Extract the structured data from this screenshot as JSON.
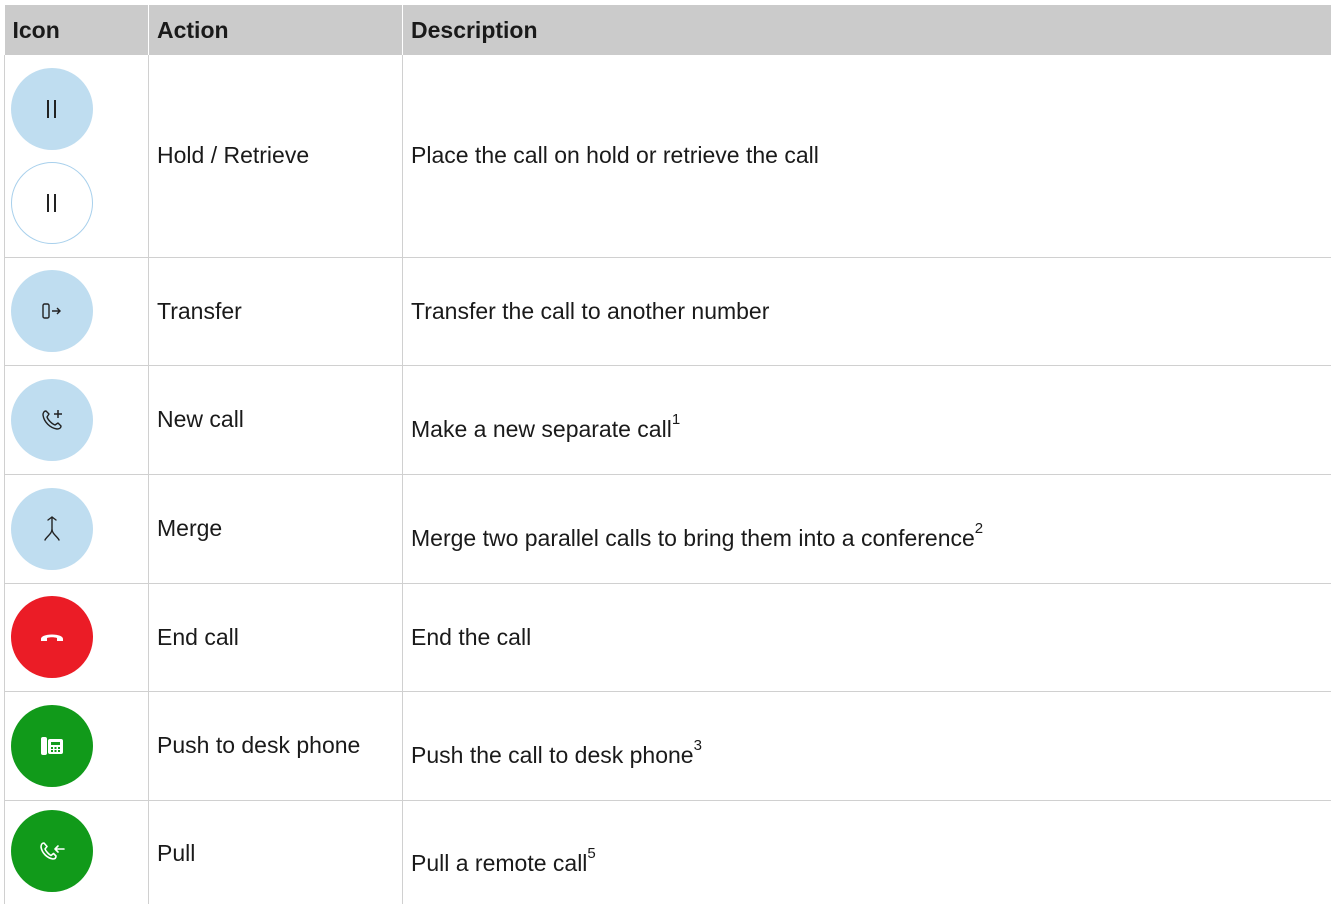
{
  "table": {
    "headers": {
      "icon": "Icon",
      "action": "Action",
      "description": "Description"
    },
    "rows": [
      {
        "icons": [
          "pause-icon",
          "pause-outline-icon"
        ],
        "action": "Hold / Retrieve",
        "description": "Place the call on hold or retrieve the call",
        "footnote": ""
      },
      {
        "icons": [
          "transfer-icon"
        ],
        "action": "Transfer",
        "description": "Transfer the call to another number",
        "footnote": ""
      },
      {
        "icons": [
          "new-call-icon"
        ],
        "action": "New call",
        "description": "Make a new separate call",
        "footnote": "1"
      },
      {
        "icons": [
          "merge-icon"
        ],
        "action": "Merge",
        "description": "Merge two parallel calls to bring them into a conference",
        "footnote": "2"
      },
      {
        "icons": [
          "end-call-icon"
        ],
        "action": "End call",
        "description": "End the call",
        "footnote": ""
      },
      {
        "icons": [
          "desk-phone-icon"
        ],
        "action": "Push to desk phone",
        "description": "Push the call to desk phone",
        "footnote": "3"
      },
      {
        "icons": [
          "pull-call-icon"
        ],
        "action": "Pull",
        "description": "Pull a remote call",
        "footnote": "5"
      }
    ]
  },
  "colors": {
    "header_bg": "#cbcbcb",
    "action_blue": "#bfddf0",
    "end_red": "#eb1c26",
    "phone_green": "#119a1a",
    "grid": "#d0d0d0"
  }
}
